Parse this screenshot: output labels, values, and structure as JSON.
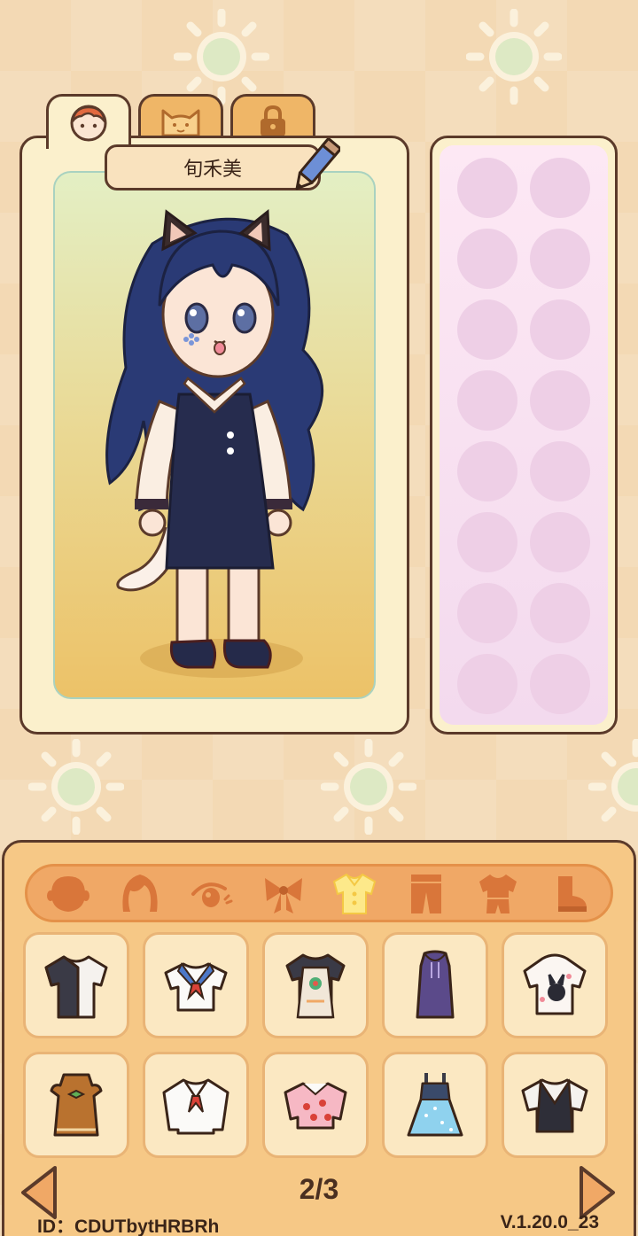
{
  "character": {
    "name": "旬禾美"
  },
  "top_tabs": [
    {
      "icon": "face-icon",
      "active": true
    },
    {
      "icon": "cat-icon",
      "active": false
    },
    {
      "icon": "lock-icon",
      "active": false
    }
  ],
  "slots_count": 16,
  "categories": [
    {
      "icon": "face-shape-icon",
      "active": false
    },
    {
      "icon": "hair-icon",
      "active": false
    },
    {
      "icon": "eye-icon",
      "active": false
    },
    {
      "icon": "bow-icon",
      "active": false
    },
    {
      "icon": "shirt-icon",
      "active": true
    },
    {
      "icon": "pants-icon",
      "active": false
    },
    {
      "icon": "outfit-icon",
      "active": false
    },
    {
      "icon": "shoe-icon",
      "active": false
    }
  ],
  "items": [
    {
      "icon": "black-white-shirt-icon"
    },
    {
      "icon": "sailor-top-icon"
    },
    {
      "icon": "apron-shirt-icon"
    },
    {
      "icon": "purple-hoodie-dress-icon"
    },
    {
      "icon": "bunny-hoodie-icon"
    },
    {
      "icon": "brown-dress-icon"
    },
    {
      "icon": "sailor-blouse-icon"
    },
    {
      "icon": "strawberry-shirt-icon"
    },
    {
      "icon": "blue-star-dress-icon"
    },
    {
      "icon": "dark-vest-top-icon"
    }
  ],
  "pagination": {
    "label": "2/3",
    "current": 2,
    "total": 3
  },
  "footer": {
    "id_text": "ID：CDUTbytHRBRh",
    "version": "V.1.20.0_23"
  },
  "colors": {
    "outline": "#5b3a2a",
    "panel": "#fbf0cc",
    "accent": "#f0a866",
    "tab": "#efb667"
  }
}
